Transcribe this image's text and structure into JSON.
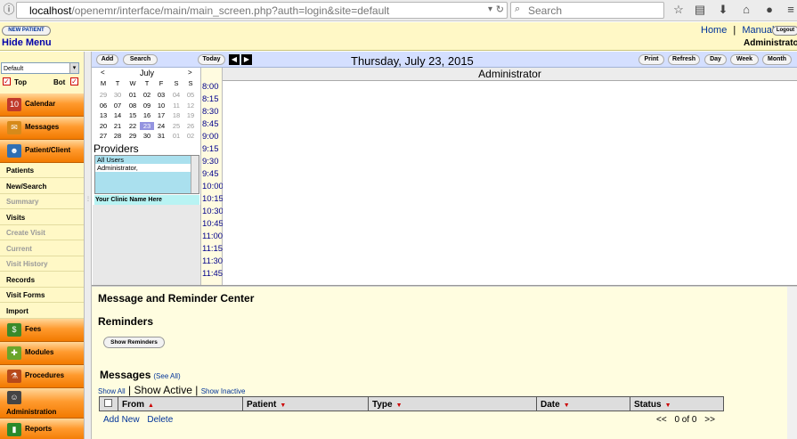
{
  "browser": {
    "url_host": "localhost",
    "url_path": "/openemr/interface/main/main_screen.php?auth=login&site=default",
    "search_placeholder": "Search"
  },
  "header": {
    "new_patient": "NEW PATIENT",
    "hide_menu": "Hide Menu",
    "home": "Home",
    "separator": "|",
    "manual": "Manual",
    "logout": "Logout",
    "user": "Administrator"
  },
  "nav": {
    "view_select": "Default",
    "top": "Top",
    "bot": "Bot",
    "items": [
      {
        "label": "Calendar",
        "type": "orange",
        "icon": "calendar-icon",
        "glyph": "10",
        "color": "#c0392b"
      },
      {
        "label": "Messages",
        "type": "orange",
        "icon": "envelope-icon",
        "glyph": "✉",
        "color": "#d68a1a"
      },
      {
        "label": "Patient/Client",
        "type": "orange",
        "icon": "person-icon",
        "glyph": "☻",
        "color": "#2f6fb3"
      },
      {
        "label": "Patients",
        "type": "sub"
      },
      {
        "label": "New/Search",
        "type": "sub"
      },
      {
        "label": "Summary",
        "type": "sub-dim"
      },
      {
        "label": "Visits",
        "type": "sub"
      },
      {
        "label": "Create Visit",
        "type": "sub-dim"
      },
      {
        "label": "Current",
        "type": "sub-dim"
      },
      {
        "label": "Visit History",
        "type": "sub-dim"
      },
      {
        "label": "Records",
        "type": "sub"
      },
      {
        "label": "Visit Forms",
        "type": "sub"
      },
      {
        "label": "Import",
        "type": "sub"
      },
      {
        "label": "Fees",
        "type": "orange",
        "icon": "money-icon",
        "glyph": "$",
        "color": "#3a8a2a"
      },
      {
        "label": "Modules",
        "type": "orange",
        "icon": "puzzle-icon",
        "glyph": "✚",
        "color": "#6aa52a"
      },
      {
        "label": "Procedures",
        "type": "orange",
        "icon": "flask-icon",
        "glyph": "⚗",
        "color": "#b84a1a"
      },
      {
        "label": "Administration",
        "type": "orange-tall",
        "icon": "admin-icon",
        "glyph": "☺",
        "color": "#444"
      },
      {
        "label": "Reports",
        "type": "orange",
        "icon": "chart-icon",
        "glyph": "▮",
        "color": "#2a8a2a"
      }
    ]
  },
  "calendar": {
    "buttons": {
      "add": "Add",
      "search": "Search",
      "today": "Today",
      "print": "Print",
      "refresh": "Refresh",
      "day": "Day",
      "week": "Week",
      "month": "Month"
    },
    "date": "Thursday, July 23, 2015",
    "month": "July",
    "prev": "<",
    "next": ">",
    "weekdays": [
      "M",
      "T",
      "W",
      "T",
      "F",
      "S",
      "S"
    ],
    "weeks": [
      [
        "29",
        "30",
        "01",
        "02",
        "03",
        "04",
        "05"
      ],
      [
        "06",
        "07",
        "08",
        "09",
        "10",
        "11",
        "12"
      ],
      [
        "13",
        "14",
        "15",
        "16",
        "17",
        "18",
        "19"
      ],
      [
        "20",
        "21",
        "22",
        "23",
        "24",
        "25",
        "26"
      ],
      [
        "27",
        "28",
        "29",
        "30",
        "31",
        "01",
        "02"
      ]
    ],
    "today": "23",
    "providers_label": "Providers",
    "providers": [
      "All Users",
      "Administrator,"
    ],
    "clinic": "Your Clinic Name Here",
    "times": [
      "8:00",
      "8:15",
      "8:30",
      "8:45",
      "9:00",
      "9:15",
      "9:30",
      "9:45",
      "10:00",
      "10:15",
      "10:30",
      "10:45",
      "11:00",
      "11:15",
      "11:30",
      "11:45"
    ],
    "provider_header": "Administrator"
  },
  "messages": {
    "title": "Message and Reminder Center",
    "reminders_title": "Reminders",
    "show_reminders": "Show Reminders",
    "messages_title": "Messages",
    "see_all": "(See All)",
    "show_all": "Show All",
    "sep": "|",
    "show_active": "Show Active",
    "show_inactive": "Show Inactive",
    "columns": [
      "From",
      "Patient",
      "Type",
      "Date",
      "Status"
    ],
    "add_new": "Add New",
    "delete": "Delete",
    "pager_prev": "<<",
    "pager_count": "0 of 0",
    "pager_next": ">>"
  }
}
